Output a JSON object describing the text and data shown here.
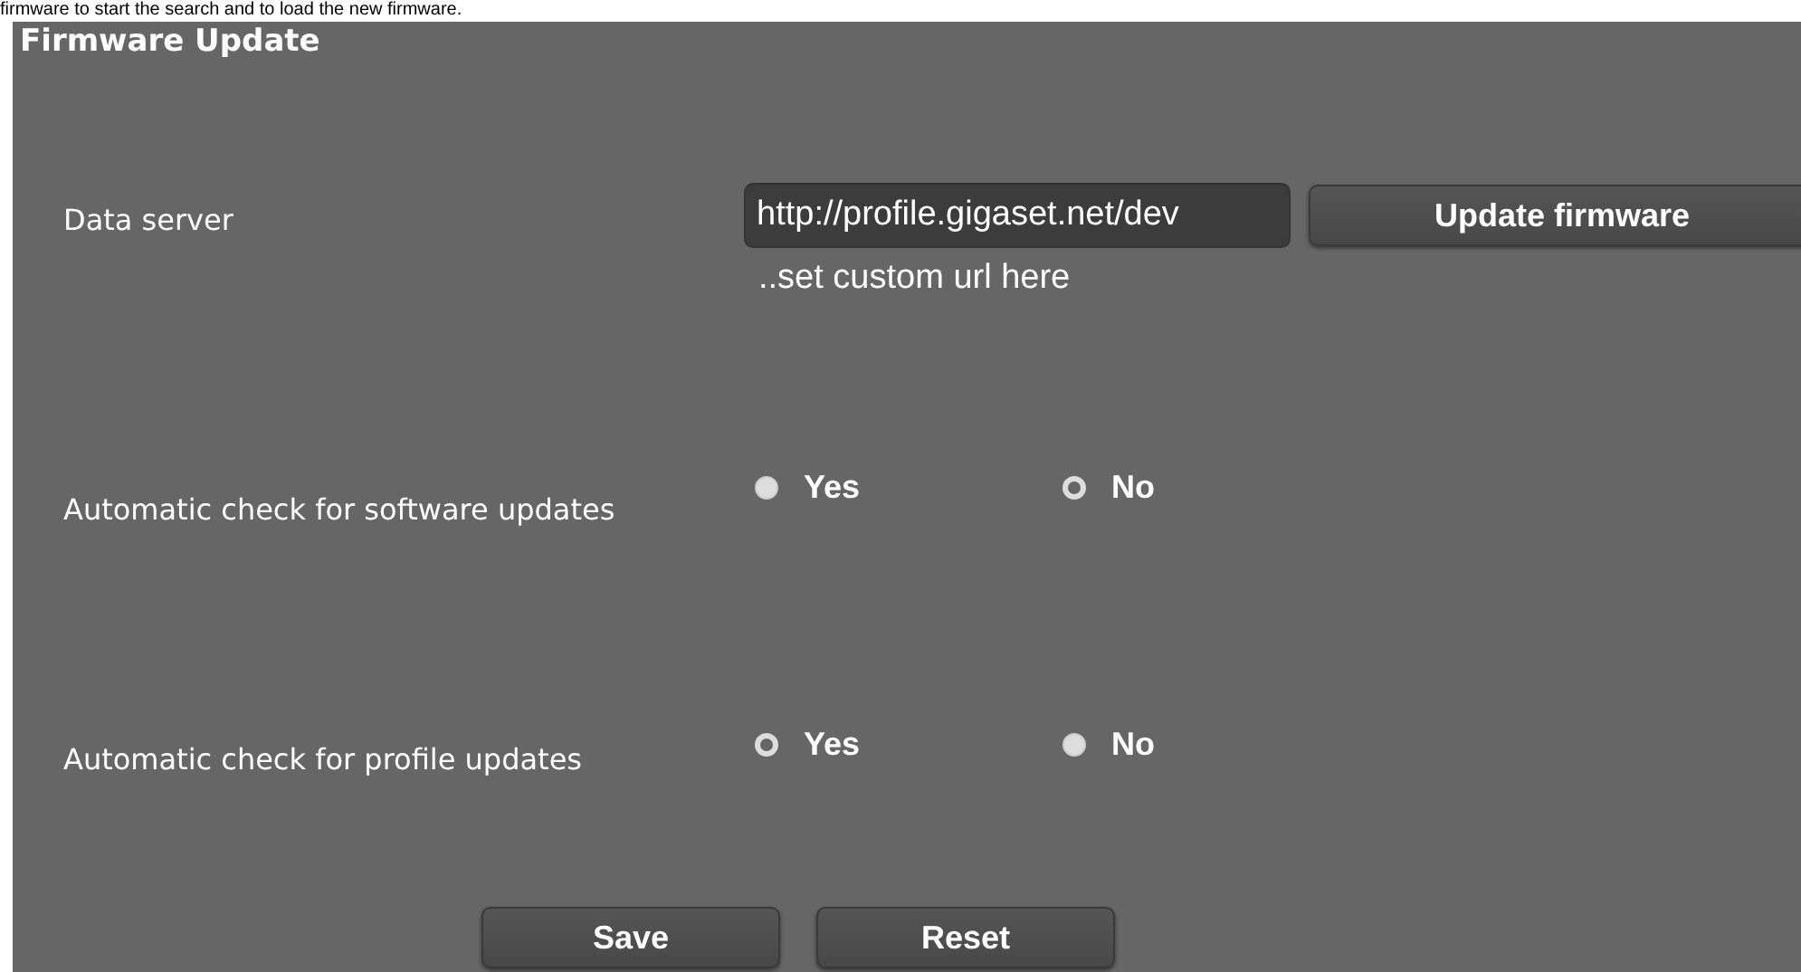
{
  "intro_text": "firmware to start the search and to load the new firmware.",
  "panel": {
    "title": "Firmware Update"
  },
  "data_server": {
    "label": "Data server",
    "value": "http://profile.gigaset.net/dev",
    "button": "Update firmware",
    "hint": "..set custom url here"
  },
  "options": [
    {
      "label": "Automatic check for software updates",
      "choices": [
        {
          "label": "Yes",
          "selected": false
        },
        {
          "label": "No",
          "selected": true
        }
      ]
    },
    {
      "label": "Automatic check for profile updates",
      "choices": [
        {
          "label": "Yes",
          "selected": true
        },
        {
          "label": "No",
          "selected": false
        }
      ]
    }
  ],
  "buttons": [
    "Save",
    "Reset"
  ]
}
